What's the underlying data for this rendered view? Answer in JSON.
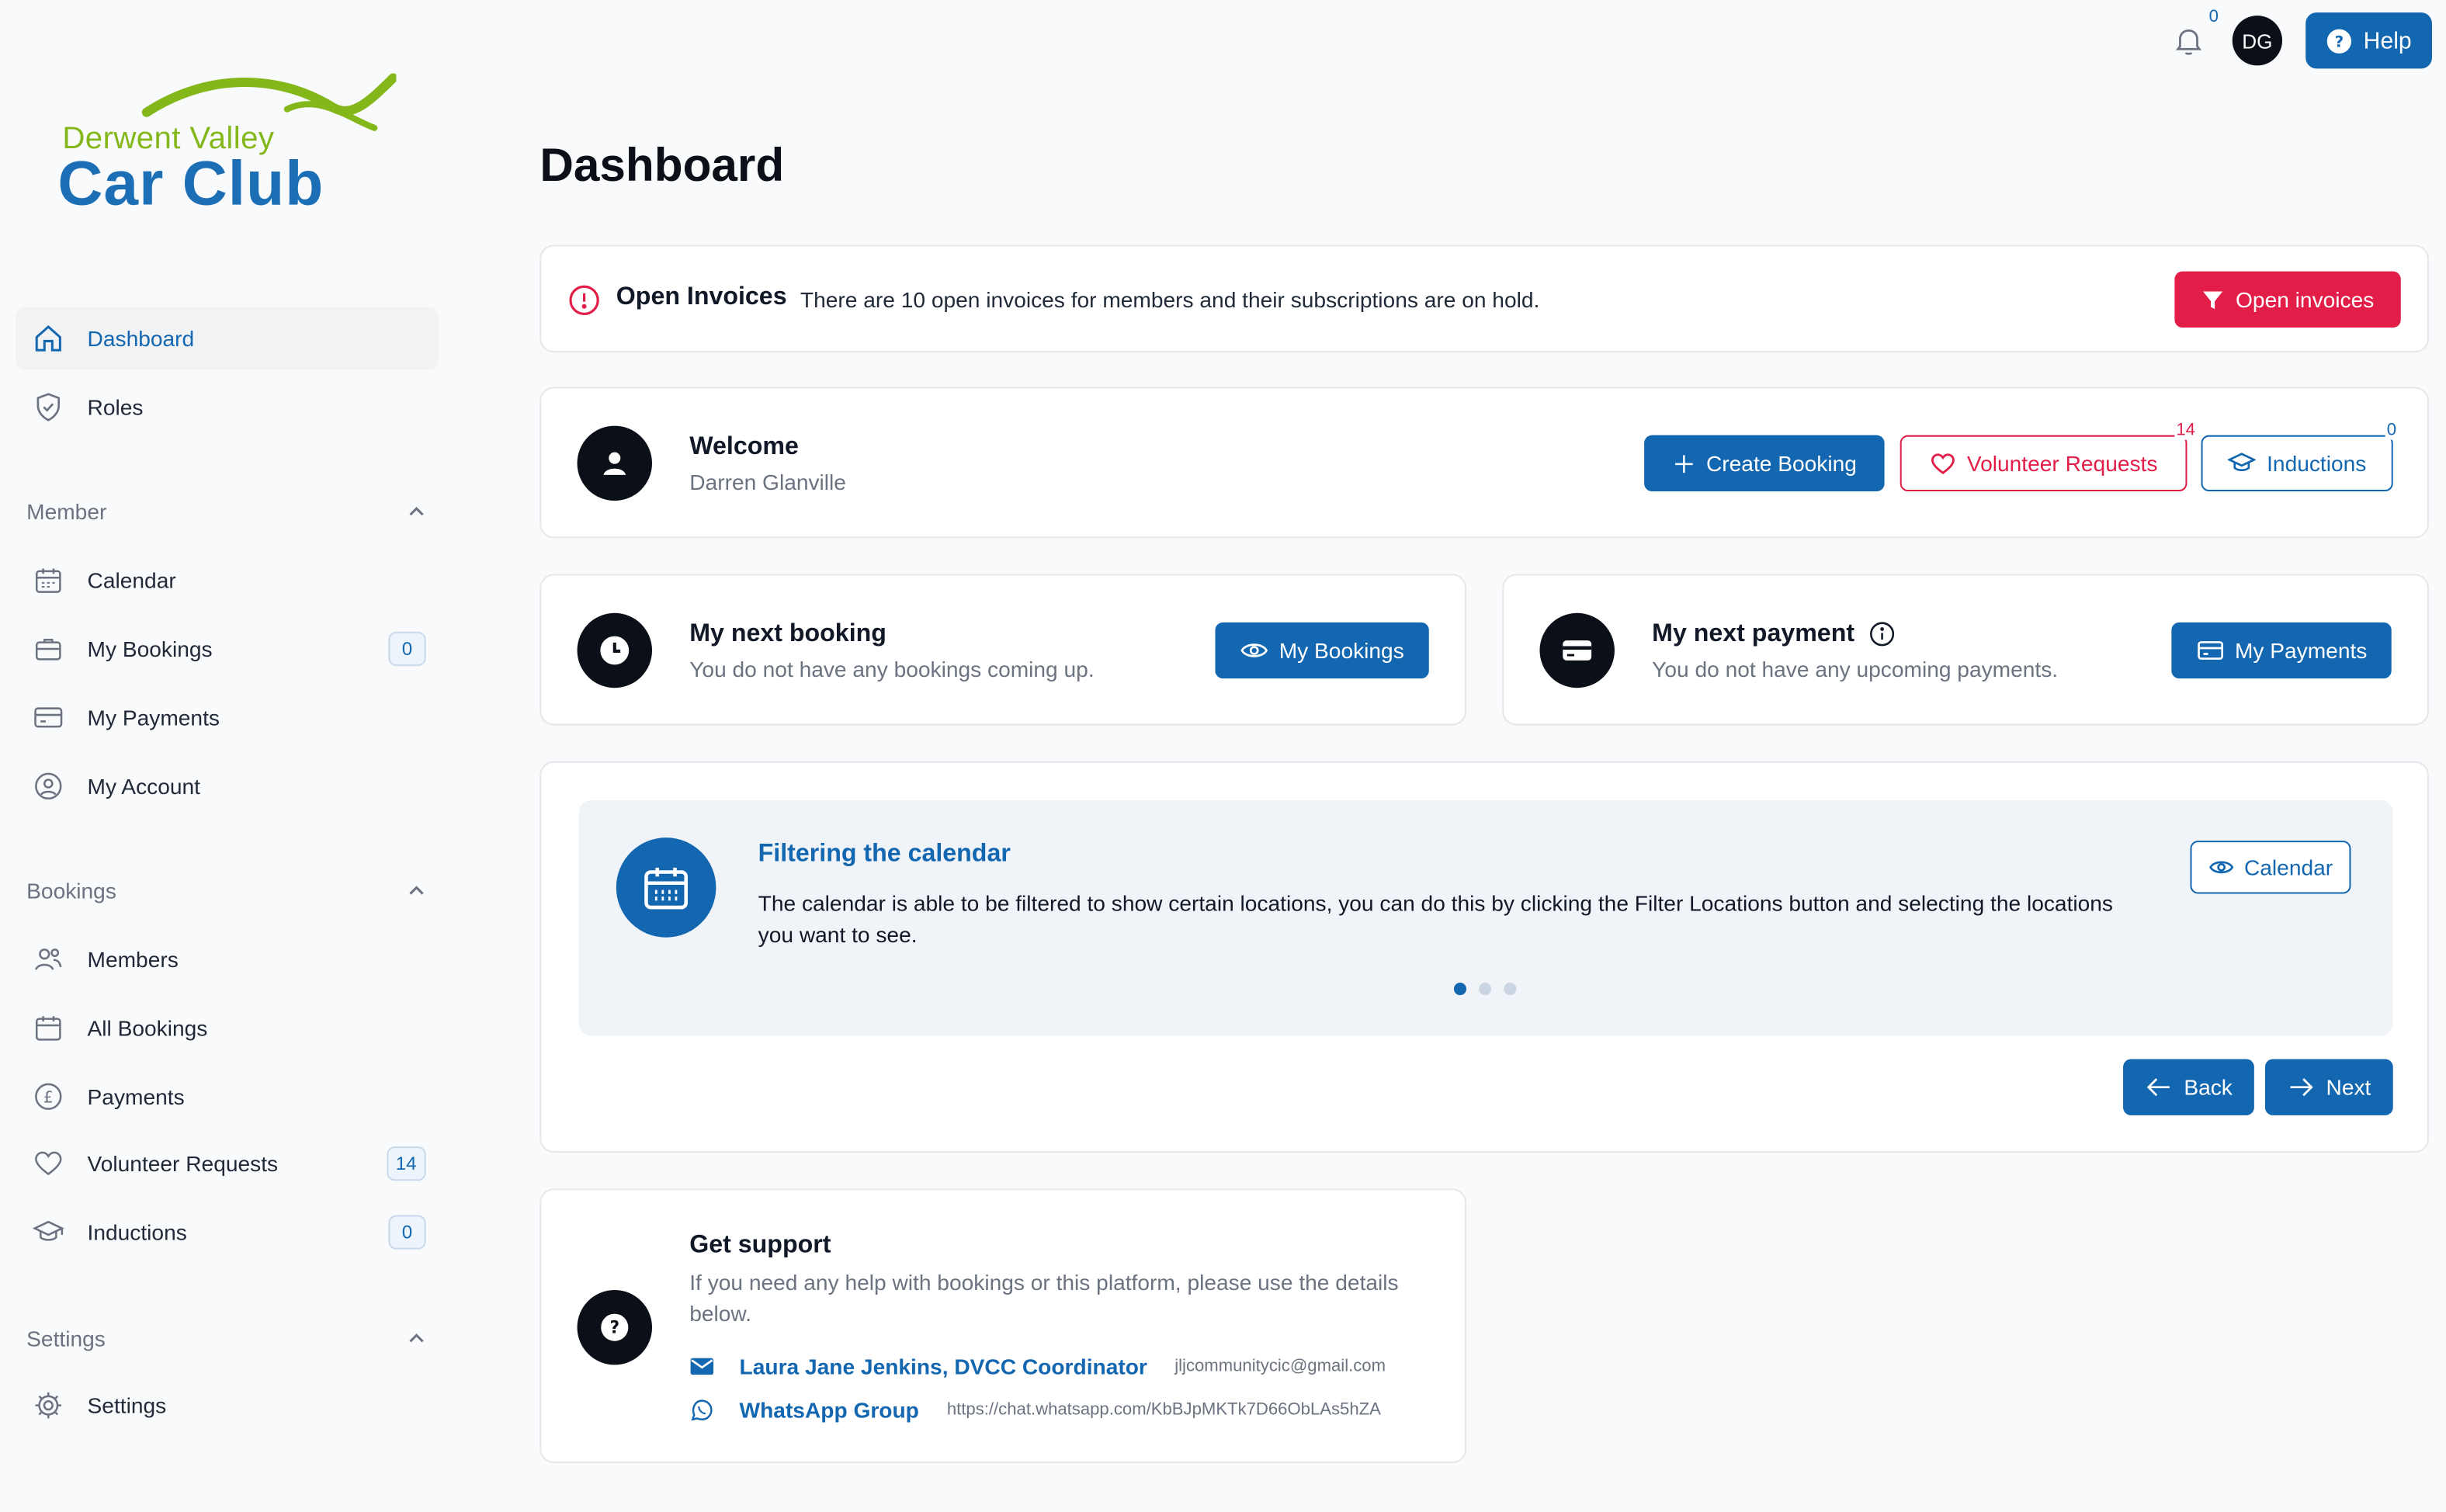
{
  "brand": {
    "line1": "Derwent Valley",
    "line2": "Car Club",
    "green": "#84b71a",
    "blue": "#1d6fb5"
  },
  "colors": {
    "primary": "#1366b0",
    "danger": "#e11d48",
    "dark": "#0b0f17"
  },
  "sidebar": {
    "top_items": [
      {
        "label": "Dashboard",
        "icon": "home-icon",
        "active": true
      },
      {
        "label": "Roles",
        "icon": "shield-check-icon"
      }
    ],
    "member": {
      "title": "Member",
      "items": [
        {
          "label": "Calendar",
          "icon": "calendar-icon"
        },
        {
          "label": "My Bookings",
          "icon": "briefcase-icon",
          "badge": "0"
        },
        {
          "label": "My Payments",
          "icon": "credit-card-icon"
        },
        {
          "label": "My Account",
          "icon": "user-circle-icon"
        }
      ]
    },
    "bookings": {
      "title": "Bookings",
      "items": [
        {
          "label": "Members",
          "icon": "users-icon"
        },
        {
          "label": "All Bookings",
          "icon": "calendar-icon"
        },
        {
          "label": "Payments",
          "icon": "pound-coin-icon"
        },
        {
          "label": "Volunteer Requests",
          "icon": "heart-icon",
          "badge": "14"
        },
        {
          "label": "Inductions",
          "icon": "graduation-cap-icon",
          "badge": "0"
        }
      ]
    },
    "settings": {
      "title": "Settings",
      "items": [
        {
          "label": "Settings",
          "icon": "gear-icon"
        }
      ]
    }
  },
  "topbar": {
    "notifications": "0",
    "avatar_initials": "DG",
    "help_label": "Help"
  },
  "page": {
    "title": "Dashboard"
  },
  "invoices_alert": {
    "title": "Open Invoices",
    "message": "There are 10 open invoices for members and their subscriptions are on hold.",
    "button": "Open invoices"
  },
  "welcome": {
    "title": "Welcome",
    "name": "Darren Glanville",
    "create_booking": "Create Booking",
    "volunteer_requests": "Volunteer Requests",
    "volunteer_count": "14",
    "inductions": "Inductions",
    "inductions_count": "0"
  },
  "next_booking": {
    "title": "My next booking",
    "text": "You do not have any bookings coming up.",
    "button": "My Bookings"
  },
  "next_payment": {
    "title": "My next payment",
    "text": "You do not have any upcoming payments.",
    "button": "My Payments"
  },
  "tip": {
    "title": "Filtering the calendar",
    "body": "The calendar is able to be filtered to show certain locations, you can do this by clicking the Filter Locations button and selecting the locations you want to see.",
    "button": "Calendar",
    "back": "Back",
    "next": "Next",
    "pages": 3,
    "current_page": 1
  },
  "support": {
    "title": "Get support",
    "text": "If you need any help with bookings or this platform, please use the details below.",
    "contact_name": "Laura Jane Jenkins, DVCC Coordinator",
    "contact_email": "jljcommunitycic@gmail.com",
    "whatsapp_label": "WhatsApp Group",
    "whatsapp_url": "https://chat.whatsapp.com/KbBJpMKTk7D66ObLAs5hZA"
  }
}
